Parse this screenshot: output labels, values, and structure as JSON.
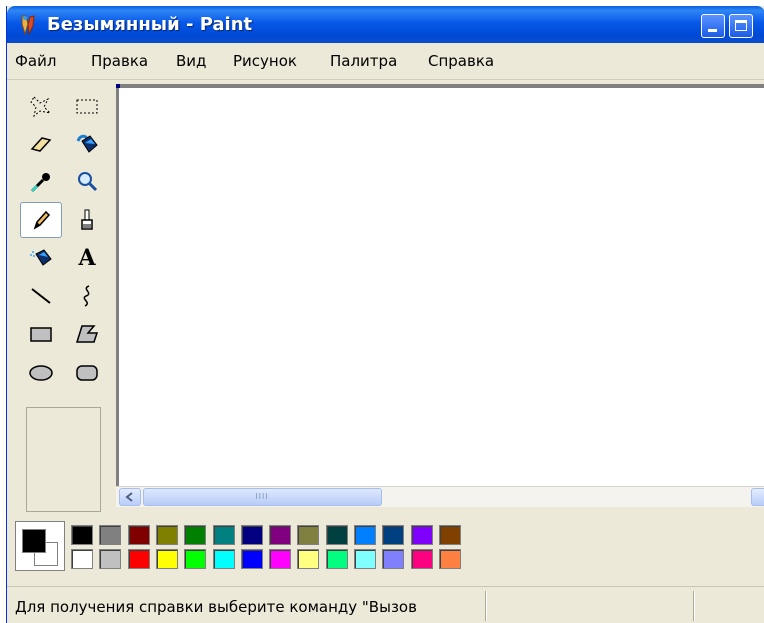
{
  "window": {
    "title": "Безымянный - Paint"
  },
  "menu": [
    {
      "label": "Файл"
    },
    {
      "label": "Правка"
    },
    {
      "label": "Вид"
    },
    {
      "label": "Рисунок"
    },
    {
      "label": "Палитра"
    },
    {
      "label": "Справка"
    }
  ],
  "tools": [
    {
      "name": "free-form-select-icon"
    },
    {
      "name": "rect-select-icon"
    },
    {
      "name": "eraser-icon"
    },
    {
      "name": "fill-bucket-icon"
    },
    {
      "name": "color-picker-icon"
    },
    {
      "name": "magnifier-icon"
    },
    {
      "name": "pencil-icon",
      "active": true
    },
    {
      "name": "brush-icon"
    },
    {
      "name": "airbrush-icon"
    },
    {
      "name": "text-icon",
      "glyph": "A"
    },
    {
      "name": "line-icon"
    },
    {
      "name": "curve-icon"
    },
    {
      "name": "rectangle-icon"
    },
    {
      "name": "polygon-icon"
    },
    {
      "name": "ellipse-icon"
    },
    {
      "name": "rounded-rect-icon"
    }
  ],
  "palette": {
    "foreground": "#000000",
    "background": "#ffffff",
    "top_row": [
      "#000000",
      "#808080",
      "#800000",
      "#808000",
      "#008000",
      "#008080",
      "#000080",
      "#800080",
      "#808040",
      "#004040",
      "#0080ff",
      "#004080",
      "#8000ff",
      "#804000"
    ],
    "bottom_row": [
      "#ffffff",
      "#c0c0c0",
      "#ff0000",
      "#ffff00",
      "#00ff00",
      "#00ffff",
      "#0000ff",
      "#ff00ff",
      "#ffff80",
      "#00ff80",
      "#80ffff",
      "#8080ff",
      "#ff0080",
      "#ff8040"
    ]
  },
  "scrollbar": {
    "grip": "IIII"
  },
  "status": {
    "text": "Для получения справки выберите команду \"Вызов"
  }
}
